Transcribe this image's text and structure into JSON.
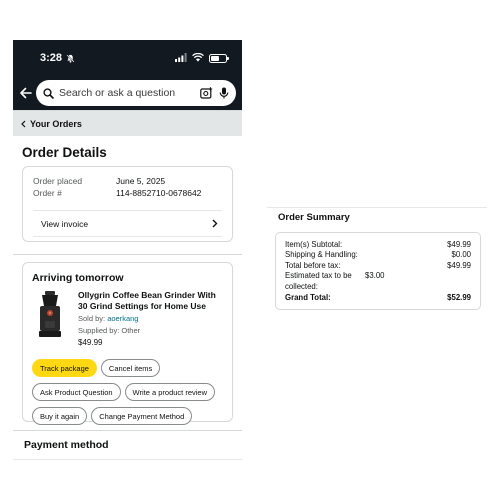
{
  "status_bar": {
    "time": "3:28"
  },
  "search": {
    "placeholder": "Search or ask a question"
  },
  "breadcrumb": {
    "label": "Your Orders"
  },
  "page": {
    "title": "Order Details"
  },
  "order_info": {
    "placed_label": "Order placed",
    "placed_value": "June 5, 2025",
    "number_label": "Order #",
    "number_value": "114-8852710-0678642",
    "invoice_label": "View invoice"
  },
  "shipment": {
    "title": "Arriving tomorrow",
    "product": {
      "name": "Ollygrin Coffee Bean Grinder With 30 Grind Settings for Home Use",
      "sold_by_label": "Sold by:",
      "sold_by_value": "aoerkang",
      "supplied_by": "Supplied by: Other",
      "price": "$49.99"
    },
    "buttons": {
      "track": "Track package",
      "cancel": "Cancel items",
      "ask": "Ask Product Question",
      "review": "Write a product review",
      "buy_again": "Buy it again",
      "change_payment": "Change Payment Method"
    }
  },
  "payment": {
    "title": "Payment method"
  },
  "order_summary": {
    "title": "Order Summary",
    "rows": [
      {
        "label": "Item(s) Subtotal:",
        "value": "$49.99"
      },
      {
        "label": "Shipping & Handling:",
        "value": "$0.00"
      },
      {
        "label": "Total before tax:",
        "value": "$49.99"
      },
      {
        "label": "Estimated tax to be collected:",
        "value": "$3.00"
      }
    ],
    "grand_total_label": "Grand Total:",
    "grand_total_value": "$52.99"
  },
  "colors": {
    "header": "#131921",
    "primary_button": "#ffd814",
    "link": "#007185"
  },
  "icons": [
    "bell-off-icon",
    "signal-icon",
    "wifi-icon",
    "battery-icon",
    "back-arrow-icon",
    "search-icon",
    "camera-icon",
    "microphone-icon",
    "chevron-left-icon",
    "chevron-right-icon"
  ],
  "battery_level": 0.6
}
